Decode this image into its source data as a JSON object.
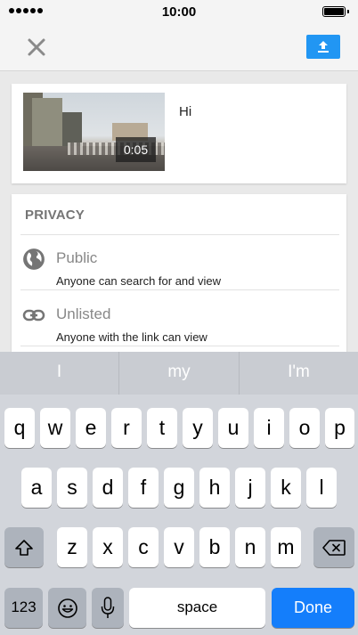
{
  "status_bar": {
    "time": "10:00"
  },
  "header": {
    "close_icon": "close-icon",
    "upload_icon": "upload-icon",
    "accent_color": "#2196f3"
  },
  "video": {
    "duration": "0:05",
    "title": "Hi"
  },
  "privacy": {
    "heading": "PRIVACY",
    "options": [
      {
        "icon": "globe-icon",
        "title": "Public",
        "description": "Anyone can search for and view"
      },
      {
        "icon": "link-icon",
        "title": "Unlisted",
        "description": "Anyone with the link can view"
      }
    ]
  },
  "keyboard": {
    "suggestions": [
      "I",
      "my",
      "I'm"
    ],
    "row1": [
      "q",
      "w",
      "e",
      "r",
      "t",
      "y",
      "u",
      "i",
      "o",
      "p"
    ],
    "row2": [
      "a",
      "s",
      "d",
      "f",
      "g",
      "h",
      "j",
      "k",
      "l"
    ],
    "row3": [
      "z",
      "x",
      "c",
      "v",
      "b",
      "n",
      "m"
    ],
    "numbers_label": "123",
    "space_label": "space",
    "done_label": "Done",
    "done_color": "#147efb"
  }
}
